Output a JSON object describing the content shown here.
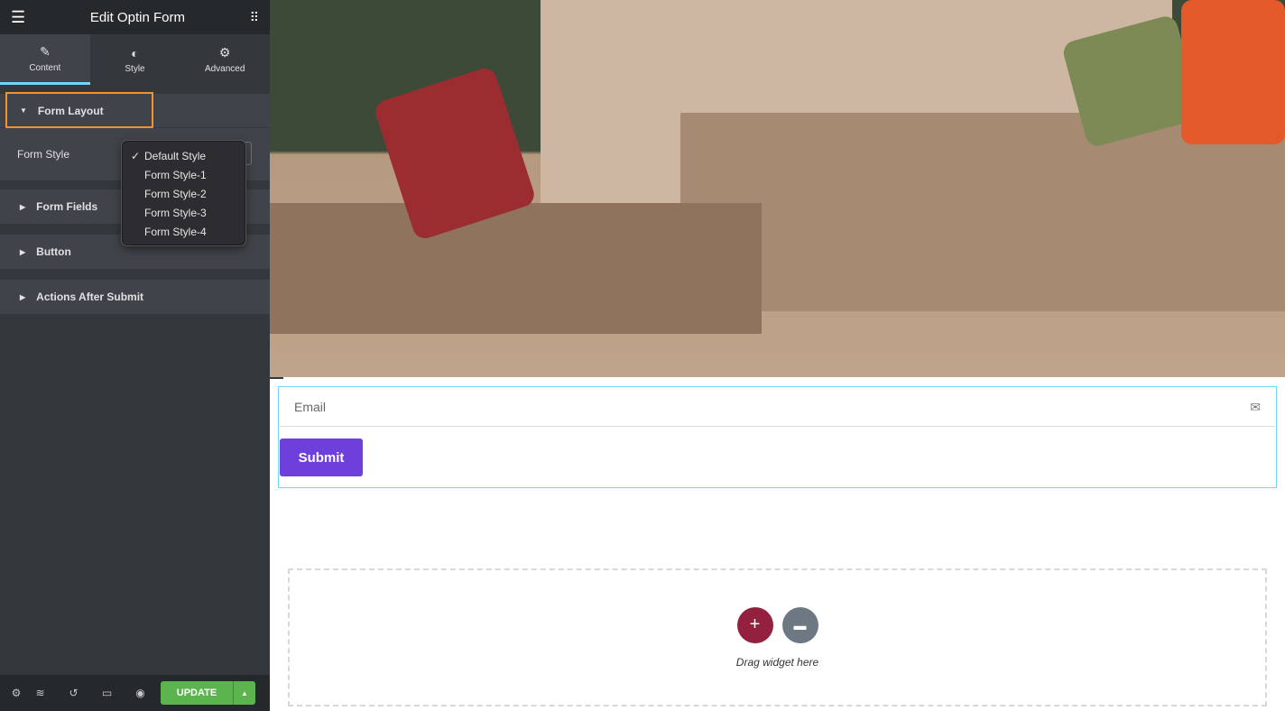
{
  "header": {
    "title": "Edit Optin Form",
    "menu_icon": "hamburger-icon",
    "apps_icon": "grid-icon"
  },
  "tabs": [
    {
      "label": "Content",
      "icon": "pencil-icon"
    },
    {
      "label": "Style",
      "icon": "contrast-icon"
    },
    {
      "label": "Advanced",
      "icon": "gear-icon"
    }
  ],
  "sections": {
    "form_layout": "Form Layout",
    "form_style_label": "Form Style",
    "form_fields": "Form Fields",
    "button": "Button",
    "actions": "Actions After Submit"
  },
  "dropdown": {
    "selected": "Default Style",
    "options": [
      "Default Style",
      "Form Style-1",
      "Form Style-2",
      "Form Style-3",
      "Form Style-4"
    ]
  },
  "footer": {
    "update": "UPDATE"
  },
  "form": {
    "email_placeholder": "Email",
    "submit": "Submit"
  },
  "dropzone": {
    "text": "Drag widget here"
  },
  "colors": {
    "accent": "#6f3fdc",
    "update": "#5bb44e",
    "highlight": "#f0932b",
    "add": "#93203e"
  }
}
